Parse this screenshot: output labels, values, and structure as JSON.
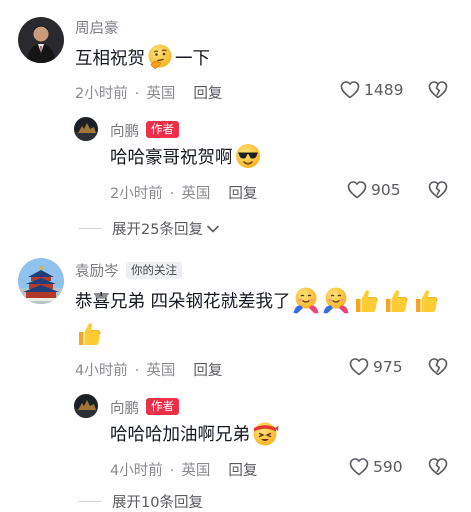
{
  "comments": [
    {
      "user": "周启豪",
      "text": "互相祝贺",
      "text_after": "一下",
      "time": "2小时前",
      "location": "英国",
      "reply_label": "回复",
      "likes": "1489",
      "emoji": "thinking-face",
      "replies": [
        {
          "user": "向鹏",
          "badge": "作者",
          "text": "哈哈豪哥祝贺啊",
          "emoji": "sunglasses-face",
          "time": "2小时前",
          "location": "英国",
          "reply_label": "回复",
          "likes": "905"
        }
      ],
      "expand_label": "展开25条回复"
    },
    {
      "user": "袁励岑",
      "badge": "你的关注",
      "text": "恭喜兄弟 四朵钢花就差我了",
      "emojis": [
        "hug-face",
        "hug-face",
        "thumbs-up",
        "thumbs-up",
        "thumbs-up",
        "thumbs-up"
      ],
      "time": "4小时前",
      "location": "英国",
      "reply_label": "回复",
      "likes": "975",
      "replies": [
        {
          "user": "向鹏",
          "badge": "作者",
          "text": "哈哈哈加油啊兄弟",
          "emoji": "headband-face",
          "time": "4小时前",
          "location": "英国",
          "reply_label": "回复",
          "likes": "590"
        }
      ],
      "expand_label": "展开10条回复"
    }
  ],
  "colors": {
    "author_badge": "#ee2f4a",
    "meta": "#8a8b91",
    "name": "#7b7c82"
  }
}
